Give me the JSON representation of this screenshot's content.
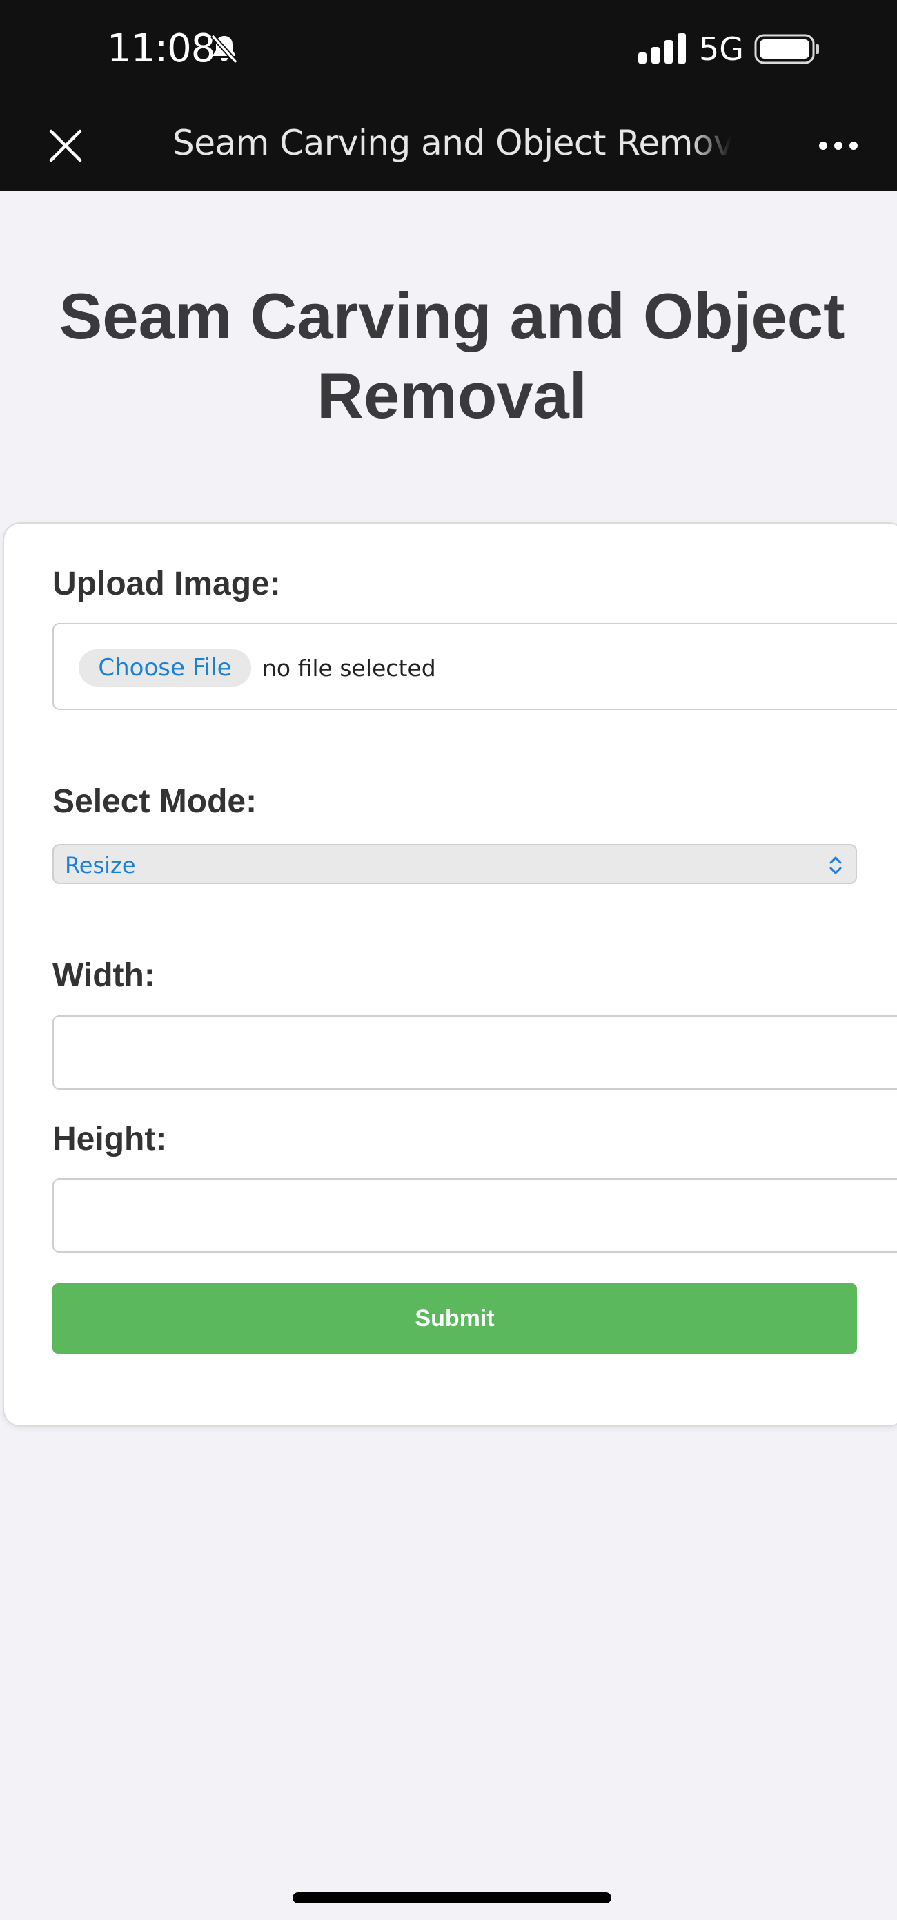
{
  "status_bar": {
    "time": "11:08",
    "network": "5G",
    "icons": [
      "bell-slash-icon",
      "signal-icon",
      "battery-icon"
    ]
  },
  "nav_bar": {
    "title": "Seam Carving and Object Removal",
    "icons": [
      "close-icon",
      "more-icon"
    ]
  },
  "page": {
    "heading": "Seam Carving and Object Removal"
  },
  "form": {
    "upload_label": "Upload Image:",
    "choose_file_label": "Choose File",
    "file_status": "no file selected",
    "mode_label": "Select Mode:",
    "mode_value": "Resize",
    "width_label": "Width:",
    "width_value": "",
    "height_label": "Height:",
    "height_value": "",
    "submit_label": "Submit"
  },
  "colors": {
    "top_bar": "#111111",
    "background": "#f2f2f7",
    "link_blue": "#1a7fd6",
    "submit_green": "#5cb85c"
  }
}
